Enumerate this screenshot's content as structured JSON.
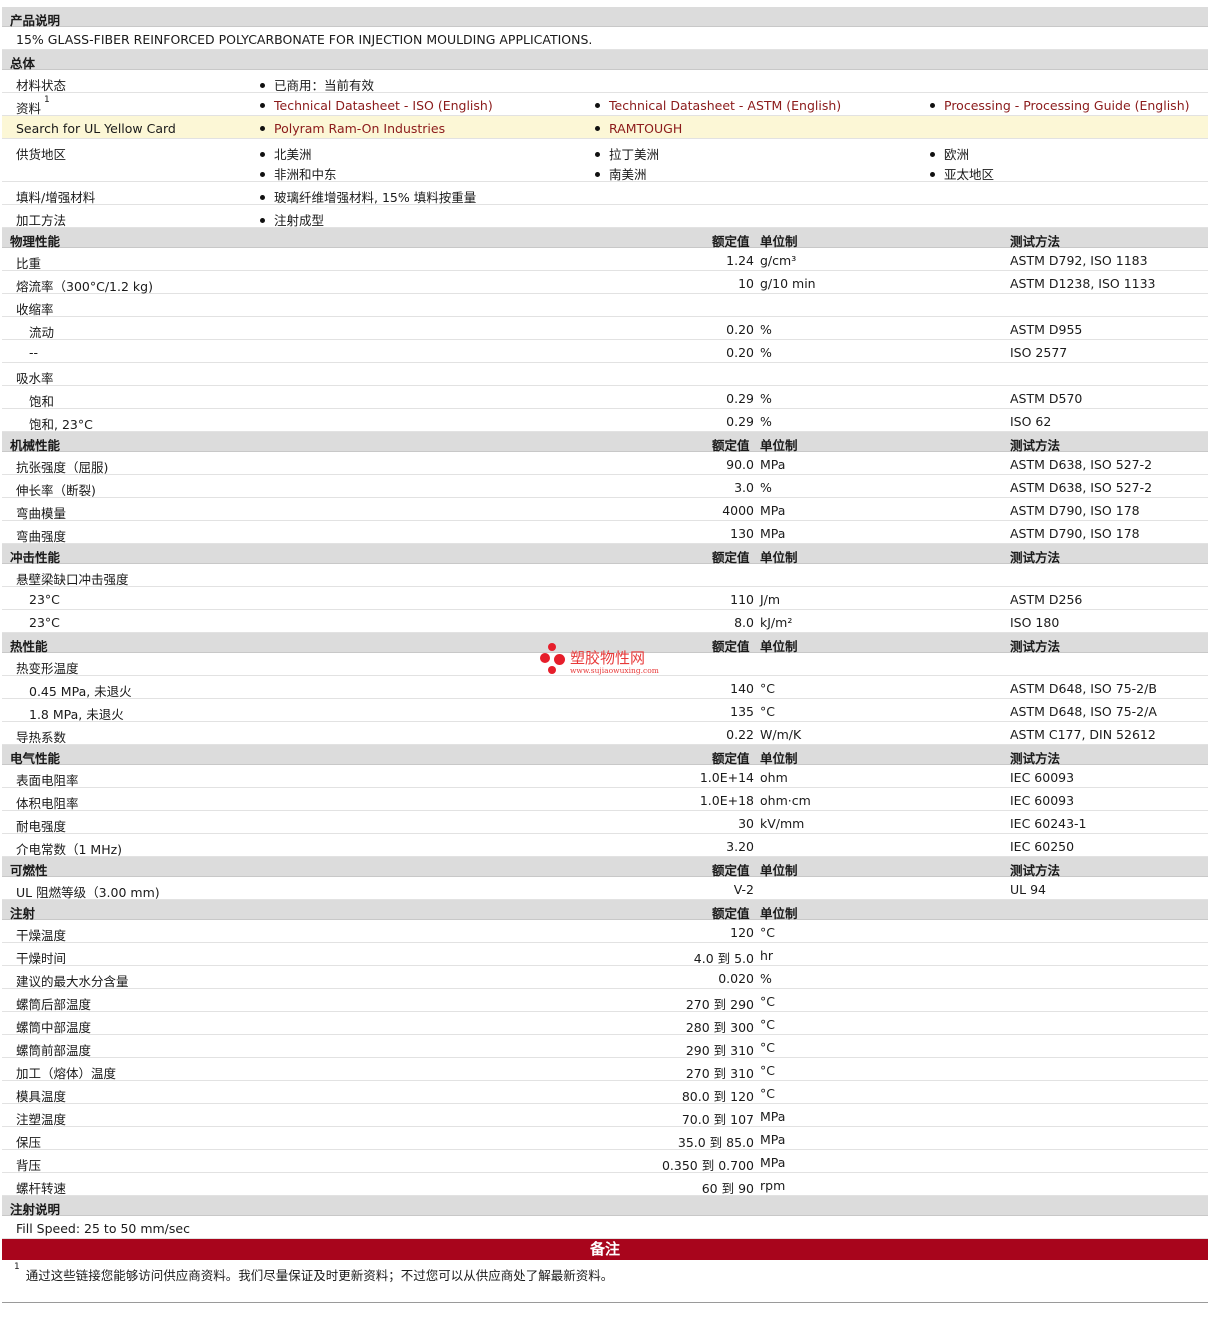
{
  "desc": {
    "title": "产品说明",
    "text": "15% GLASS-FIBER REINFORCED POLYCARBONATE FOR INJECTION MOULDING APPLICATIONS."
  },
  "general": {
    "title": "总体",
    "status_label": "材料状态",
    "status_value": "已商用：当前有效",
    "resources_label": "资料",
    "resources_sup": "1",
    "resources": [
      "Technical Datasheet - ISO (English)",
      "Technical Datasheet - ASTM (English)",
      "Processing - Processing Guide (English)"
    ],
    "ul_label": "Search for UL Yellow Card",
    "ul_links": [
      "Polyram Ram-On Industries",
      "RAMTOUGH"
    ],
    "regions_label": "供货地区",
    "regions": [
      "北美洲",
      "拉丁美洲",
      "欧洲",
      "非洲和中东",
      "南美洲",
      "亚太地区"
    ],
    "filler_label": "填料/增强材料",
    "filler_value": "玻璃纤维增强材料, 15% 填料按重量",
    "process_label": "加工方法",
    "process_value": "注射成型"
  },
  "col_headers": {
    "value": "额定值",
    "unit": "单位制",
    "method": "测试方法"
  },
  "physical": {
    "title": "物理性能",
    "rows": [
      {
        "label": "比重",
        "value": "1.24",
        "unit": "g/cm³",
        "method": "ASTM D792, ISO 1183"
      },
      {
        "label": "熔流率（300°C/1.2 kg)",
        "value": "10",
        "unit": "g/10 min",
        "method": "ASTM D1238, ISO 1133"
      },
      {
        "label": "收缩率"
      },
      {
        "label": "流动",
        "value": "0.20",
        "unit": "%",
        "method": "ASTM D955"
      },
      {
        "label": "--",
        "value": "0.20",
        "unit": "%",
        "method": "ISO 2577"
      },
      {
        "label": "吸水率"
      },
      {
        "label": "饱和",
        "value": "0.29",
        "unit": "%",
        "method": "ASTM D570"
      },
      {
        "label": "饱和, 23°C",
        "value": "0.29",
        "unit": "%",
        "method": "ISO 62"
      }
    ]
  },
  "mechanical": {
    "title": "机械性能",
    "rows": [
      {
        "label": "抗张强度（屈服)",
        "value": "90.0",
        "unit": "MPa",
        "method": "ASTM D638, ISO 527-2"
      },
      {
        "label": "伸长率（断裂)",
        "value": "3.0",
        "unit": "%",
        "method": "ASTM D638, ISO 527-2"
      },
      {
        "label": "弯曲模量",
        "value": "4000",
        "unit": "MPa",
        "method": "ASTM D790, ISO 178"
      },
      {
        "label": "弯曲强度",
        "value": "130",
        "unit": "MPa",
        "method": "ASTM D790, ISO 178"
      }
    ]
  },
  "impact": {
    "title": "冲击性能",
    "rows": [
      {
        "label": "悬壁梁缺口冲击强度"
      },
      {
        "label": "23°C",
        "value": "110",
        "unit": "J/m",
        "method": "ASTM D256"
      },
      {
        "label": "23°C",
        "value": "8.0",
        "unit": "kJ/m²",
        "method": "ISO 180"
      }
    ]
  },
  "thermal": {
    "title": "热性能",
    "rows": [
      {
        "label": "热变形温度"
      },
      {
        "label": "0.45 MPa, 未退火",
        "value": "140",
        "unit": "°C",
        "method": "ASTM D648, ISO 75-2/B"
      },
      {
        "label": "1.8 MPa, 未退火",
        "value": "135",
        "unit": "°C",
        "method": "ASTM D648, ISO 75-2/A"
      },
      {
        "label": "导热系数",
        "value": "0.22",
        "unit": "W/m/K",
        "method": "ASTM C177, DIN 52612"
      }
    ]
  },
  "electrical": {
    "title": "电气性能",
    "rows": [
      {
        "label": "表面电阻率",
        "value": "1.0E+14",
        "unit": "ohm",
        "method": "IEC 60093"
      },
      {
        "label": "体积电阻率",
        "value": "1.0E+18",
        "unit": "ohm·cm",
        "method": "IEC 60093"
      },
      {
        "label": "耐电强度",
        "value": "30",
        "unit": "kV/mm",
        "method": "IEC 60243-1"
      },
      {
        "label": "介电常数（1 MHz)",
        "value": "3.20",
        "unit": "",
        "method": "IEC 60250"
      }
    ]
  },
  "flammability": {
    "title": "可燃性",
    "rows": [
      {
        "label": "UL 阻燃等级（3.00 mm)",
        "value": "V-2",
        "unit": "",
        "method": "UL 94"
      }
    ]
  },
  "injection": {
    "title": "注射",
    "rows": [
      {
        "label": "干燥温度",
        "value": "120",
        "unit": "°C"
      },
      {
        "label": "干燥时间",
        "value": "4.0 到  5.0",
        "unit": "hr"
      },
      {
        "label": "建议的最大水分含量",
        "value": "0.020",
        "unit": "%"
      },
      {
        "label": "螺筒后部温度",
        "value": "270 到  290",
        "unit": "°C"
      },
      {
        "label": "螺筒中部温度",
        "value": "280 到  300",
        "unit": "°C"
      },
      {
        "label": "螺筒前部温度",
        "value": "290 到  310",
        "unit": "°C"
      },
      {
        "label": "加工（熔体）温度",
        "value": "270 到  310",
        "unit": "°C"
      },
      {
        "label": "模具温度",
        "value": "80.0 到  120",
        "unit": "°C"
      },
      {
        "label": "注塑温度",
        "value": "70.0 到  107",
        "unit": "MPa"
      },
      {
        "label": "保压",
        "value": "35.0 到  85.0",
        "unit": "MPa"
      },
      {
        "label": "背压",
        "value": "0.350 到  0.700",
        "unit": "MPa"
      },
      {
        "label": "螺杆转速",
        "value": "60 到  90",
        "unit": "rpm"
      }
    ]
  },
  "injection_notes": {
    "title": "注射说明",
    "text": "Fill Speed: 25 to 50 mm/sec"
  },
  "remarks": {
    "title": "备注",
    "sup": "1",
    "text": "通过这些链接您能够访问供应商资料。我们尽量保证及时更新资料；不过您可以从供应商处了解最新资料。"
  },
  "watermark": {
    "title": "塑胶物性网",
    "url": "www.sujiaowuxing.com"
  },
  "colors": {
    "header_bg": "#dcdcdc",
    "link": "#8b1a1a",
    "remarks_bar": "#a8051c",
    "highlight": "#fcf7d6"
  }
}
